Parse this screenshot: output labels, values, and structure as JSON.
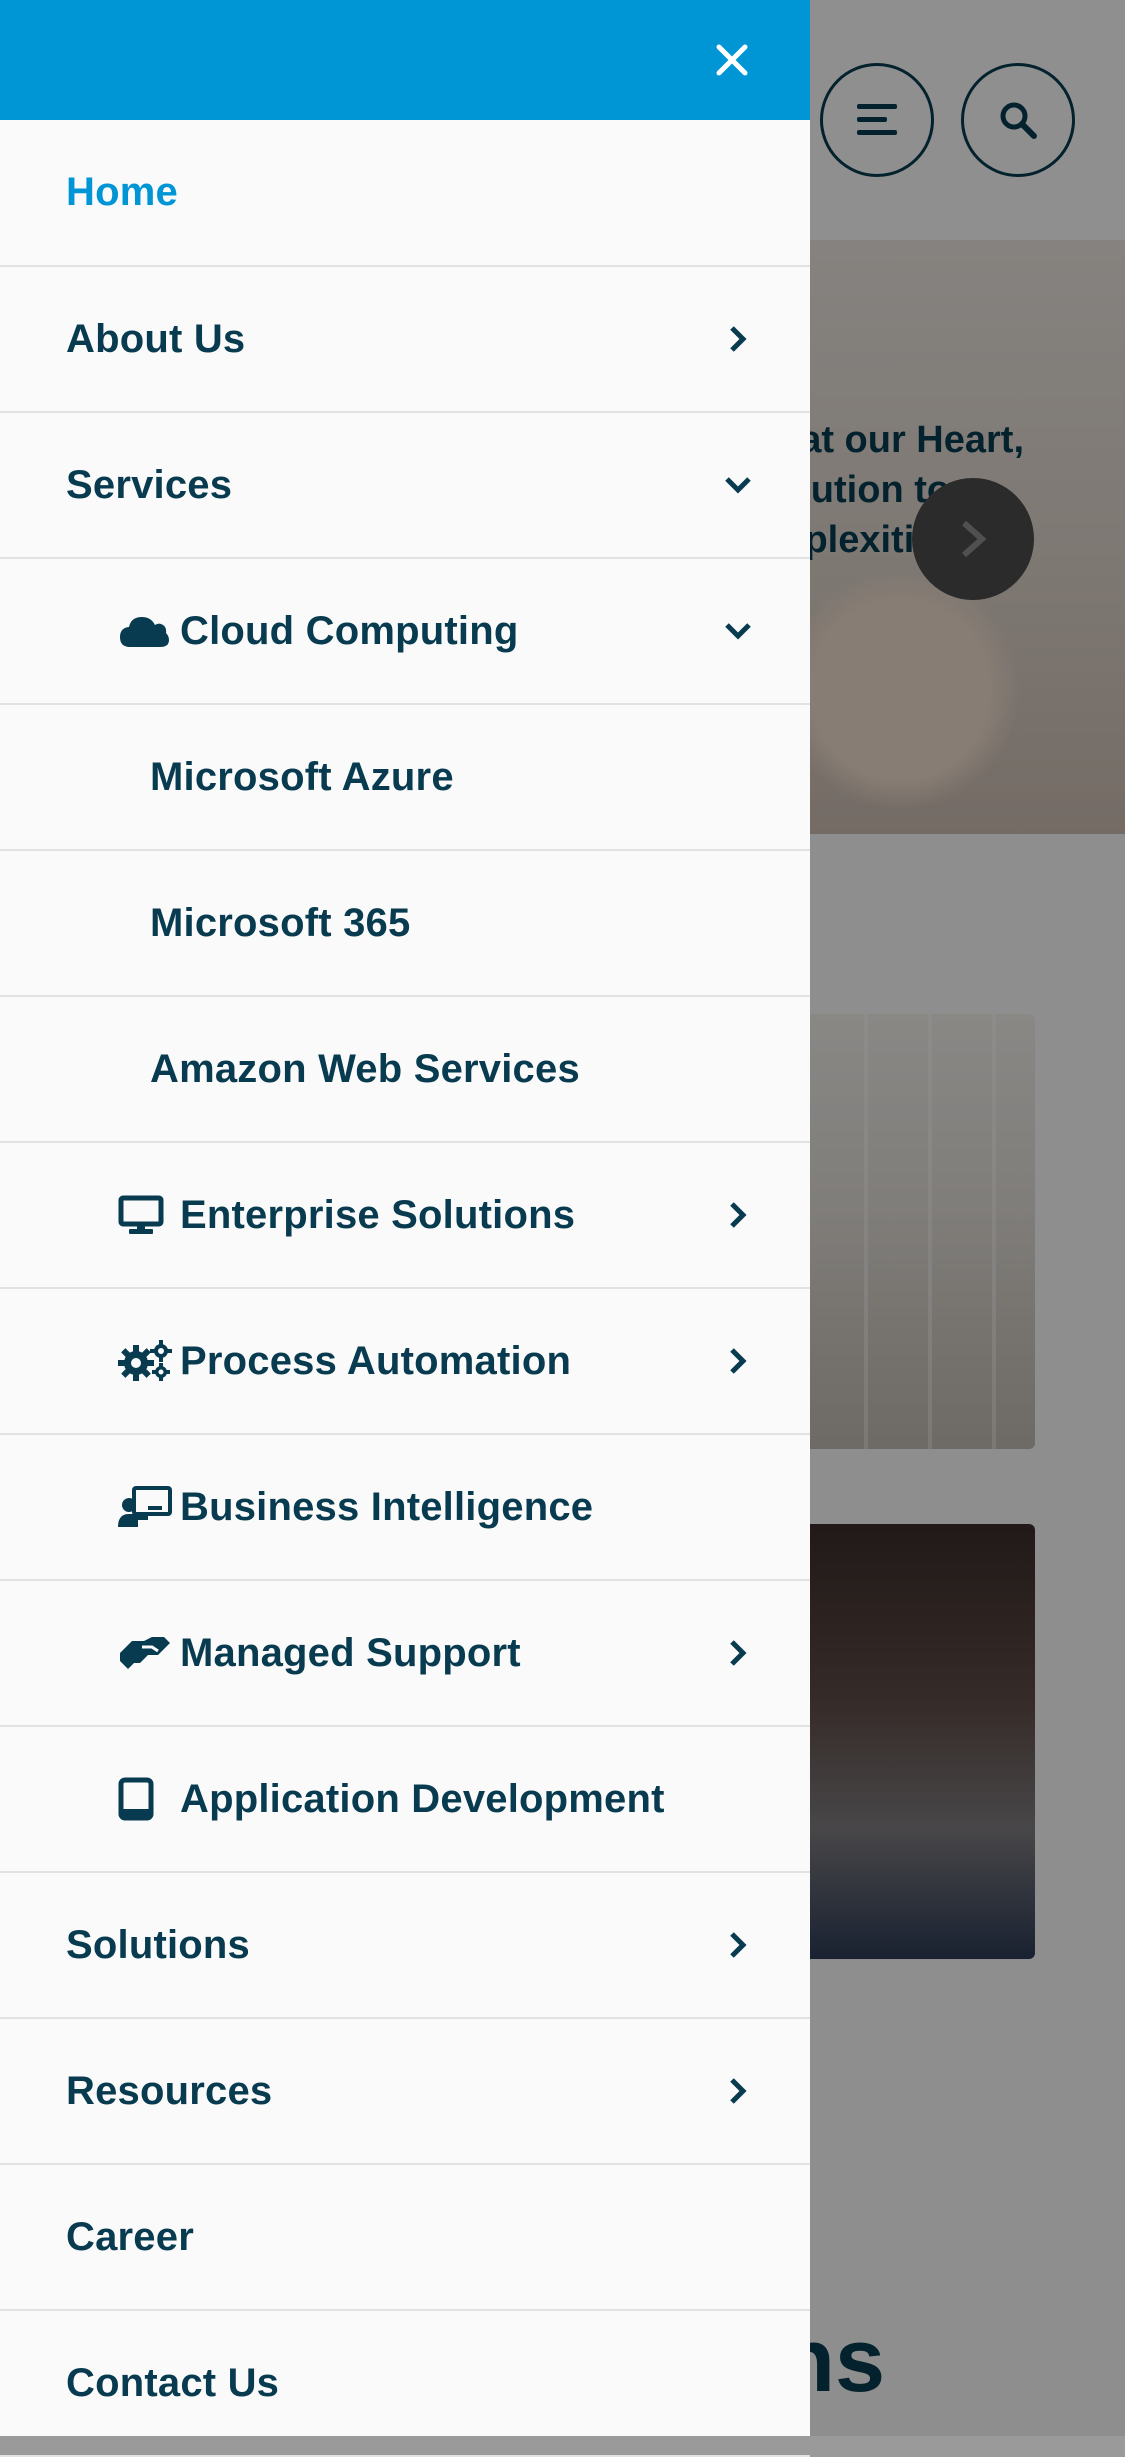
{
  "background": {
    "hero_text_lines": [
      "tion at our Heart,",
      "e Solution to",
      "Complexities!"
    ],
    "big_word": "ns"
  },
  "drawer": {
    "accent_color": "#0096d6",
    "text_color": "#083b4f",
    "items": [
      {
        "label": "Home",
        "level": 0,
        "active": true,
        "chevron": "none"
      },
      {
        "label": "About Us",
        "level": 0,
        "chevron": "right"
      },
      {
        "label": "Services",
        "level": 0,
        "chevron": "down"
      },
      {
        "label": "Cloud Computing",
        "level": 1,
        "icon": "cloud-icon",
        "chevron": "down"
      },
      {
        "label": "Microsoft Azure",
        "level": 2,
        "chevron": "none"
      },
      {
        "label": "Microsoft 365",
        "level": 2,
        "chevron": "none"
      },
      {
        "label": "Amazon Web Services",
        "level": 2,
        "chevron": "none"
      },
      {
        "label": "Enterprise Solutions",
        "level": 1,
        "icon": "desktop-icon",
        "chevron": "right"
      },
      {
        "label": "Process Automation",
        "level": 1,
        "icon": "gears-icon",
        "chevron": "right"
      },
      {
        "label": "Business Intelligence",
        "level": 1,
        "icon": "chalkboard-teacher-icon",
        "chevron": "none"
      },
      {
        "label": "Managed Support",
        "level": 1,
        "icon": "handshake-icon",
        "chevron": "right"
      },
      {
        "label": "Application Development",
        "level": 1,
        "icon": "tablet-icon",
        "chevron": "none"
      },
      {
        "label": "Solutions",
        "level": 0,
        "chevron": "right"
      },
      {
        "label": "Resources",
        "level": 0,
        "chevron": "right"
      },
      {
        "label": "Career",
        "level": 0,
        "chevron": "none"
      },
      {
        "label": "Contact Us",
        "level": 0,
        "chevron": "none"
      }
    ]
  }
}
